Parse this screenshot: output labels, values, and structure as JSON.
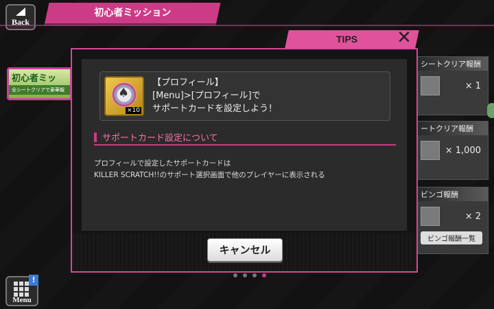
{
  "header": {
    "back_label": "Back",
    "title": "初心者ミッション"
  },
  "background": {
    "mission_banner_title": "初心者ミッ",
    "mission_banner_sub": "全シートクリアで豪華報",
    "rewards": [
      {
        "title": "シートクリア報酬",
        "count": "× 1"
      },
      {
        "title": "ートクリア報酬",
        "count": "× 1,000"
      },
      {
        "title": "ビンゴ報酬",
        "count": "× 2"
      }
    ],
    "bingo_list_button": "ビンゴ報酬一覧"
  },
  "tips": {
    "label": "TIPS",
    "close_glyph": "✕"
  },
  "modal": {
    "info": {
      "heading": "【プロフィール】",
      "line1": "[Menu]>[プロフィール]で",
      "line2": "サポートカードを設定しよう！",
      "item_count": "×10"
    },
    "section_title": "サポートカード設定について",
    "description": [
      "プロフィールで設定したサポートカードは",
      "KILLER SCRATCH!!のサポート選択画面で他のプレイヤーに表示される"
    ],
    "cancel_label": "キャンセル"
  },
  "menu": {
    "label": "Menu",
    "alert": "!"
  },
  "colors": {
    "accent": "#cc3c86",
    "tips_tab": "#e0539c"
  },
  "icons": [
    "back-arrow-icon",
    "close-icon",
    "emblem-icon",
    "menu-grid-icon",
    "alert-icon"
  ]
}
